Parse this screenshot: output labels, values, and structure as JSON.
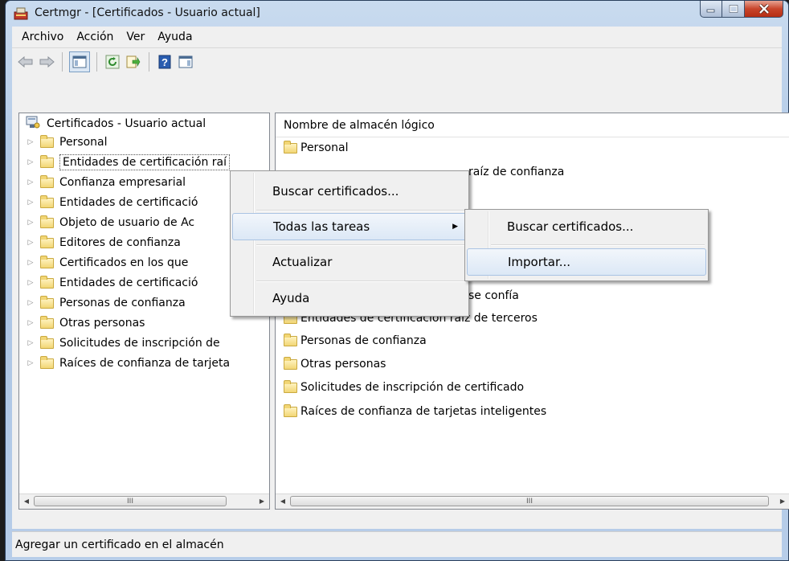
{
  "window": {
    "title": "Certmgr - [Certificados - Usuario actual]"
  },
  "menubar": {
    "items": [
      "Archivo",
      "Acción",
      "Ver",
      "Ayuda"
    ]
  },
  "toolbar": {
    "icons": [
      "back-arrow-icon",
      "forward-arrow-icon",
      "show-hide-console-tree-icon",
      "refresh-icon",
      "export-list-icon",
      "help-icon",
      "action-pane-icon"
    ]
  },
  "tree": {
    "root": "Certificados - Usuario actual",
    "items": [
      "Personal",
      "Entidades de certificación raí",
      "Confianza empresarial",
      "Entidades de certificació",
      "Objeto de usuario de Ac",
      "Editores de confianza",
      "Certificados en los que",
      "Entidades de certificació",
      "Personas de confianza",
      "Otras personas",
      "Solicitudes de inscripción de",
      "Raíces de confianza de tarjeta"
    ]
  },
  "list": {
    "column_header": "Nombre de almacén lógico",
    "items": [
      "Personal",
      "raíz de confianza",
      "se confía",
      "Entidades de certificación raíz de terceros",
      "Personas de confianza",
      "Otras personas",
      "Solicitudes de inscripción de certificado",
      "Raíces de confianza de tarjetas inteligentes"
    ]
  },
  "context_menu": {
    "items": [
      "Buscar certificados...",
      "Todas las tareas",
      "Actualizar",
      "Ayuda"
    ],
    "highlighted": "Todas las tareas"
  },
  "submenu": {
    "items": [
      "Buscar certificados...",
      "Importar..."
    ],
    "highlighted": "Importar..."
  },
  "scrollbar_grip": "III",
  "statusbar": {
    "text": "Agregar un certificado en el almacén"
  }
}
